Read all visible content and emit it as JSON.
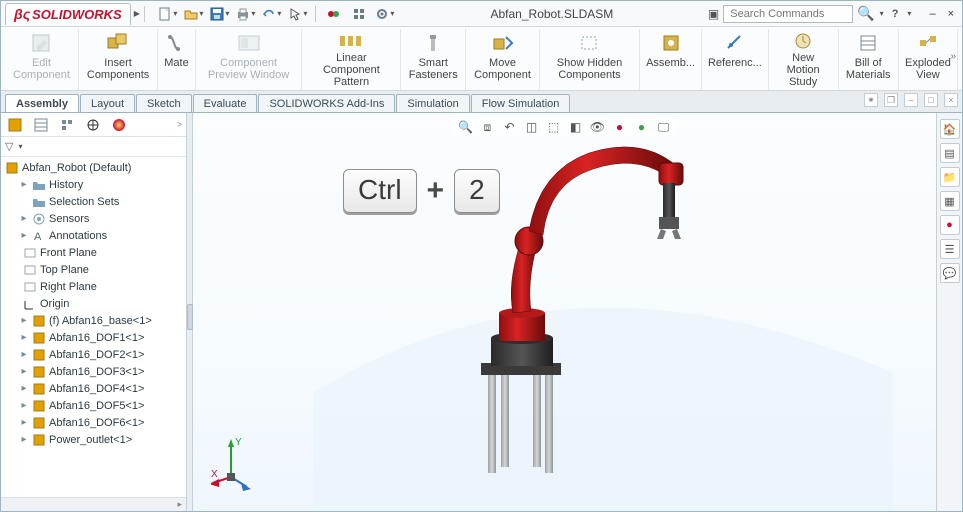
{
  "app": {
    "brand": "SOLIDWORKS",
    "document_title": "Abfan_Robot.SLDASM"
  },
  "search": {
    "placeholder": "Search Commands"
  },
  "ribbon": {
    "edit_component": "Edit Component",
    "insert_components": "Insert Components",
    "mate": "Mate",
    "component_preview": "Component Preview Window",
    "linear_pattern": "Linear Component Pattern",
    "smart_fasteners": "Smart Fasteners",
    "move_component": "Move Component",
    "show_hidden": "Show Hidden Components",
    "assembly": "Assemb...",
    "reference": "Referenc...",
    "new_motion_study": "New Motion Study",
    "bom": "Bill of Materials",
    "exploded_view": "Exploded View"
  },
  "tabs": {
    "assembly": "Assembly",
    "layout": "Layout",
    "sketch": "Sketch",
    "evaluate": "Evaluate",
    "addins": "SOLIDWORKS Add-Ins",
    "simulation": "Simulation",
    "flow": "Flow Simulation"
  },
  "tree": {
    "root": "Abfan_Robot  (Default)",
    "history": "History",
    "selection_sets": "Selection Sets",
    "sensors": "Sensors",
    "annotations": "Annotations",
    "front_plane": "Front Plane",
    "top_plane": "Top Plane",
    "right_plane": "Right Plane",
    "origin": "Origin",
    "comp1": "(f) Abfan16_base<1>",
    "comp2": "Abfan16_DOF1<1>",
    "comp3": "Abfan16_DOF2<1>",
    "comp4": "Abfan16_DOF3<1>",
    "comp5": "Abfan16_DOF4<1>",
    "comp6": "Abfan16_DOF5<1>",
    "comp7": "Abfan16_DOF6<1>",
    "comp8": "Power_outlet<1>"
  },
  "overlay": {
    "key1": "Ctrl",
    "plus": "+",
    "key2": "2"
  },
  "triad": {
    "x": "X",
    "y": "Y"
  }
}
